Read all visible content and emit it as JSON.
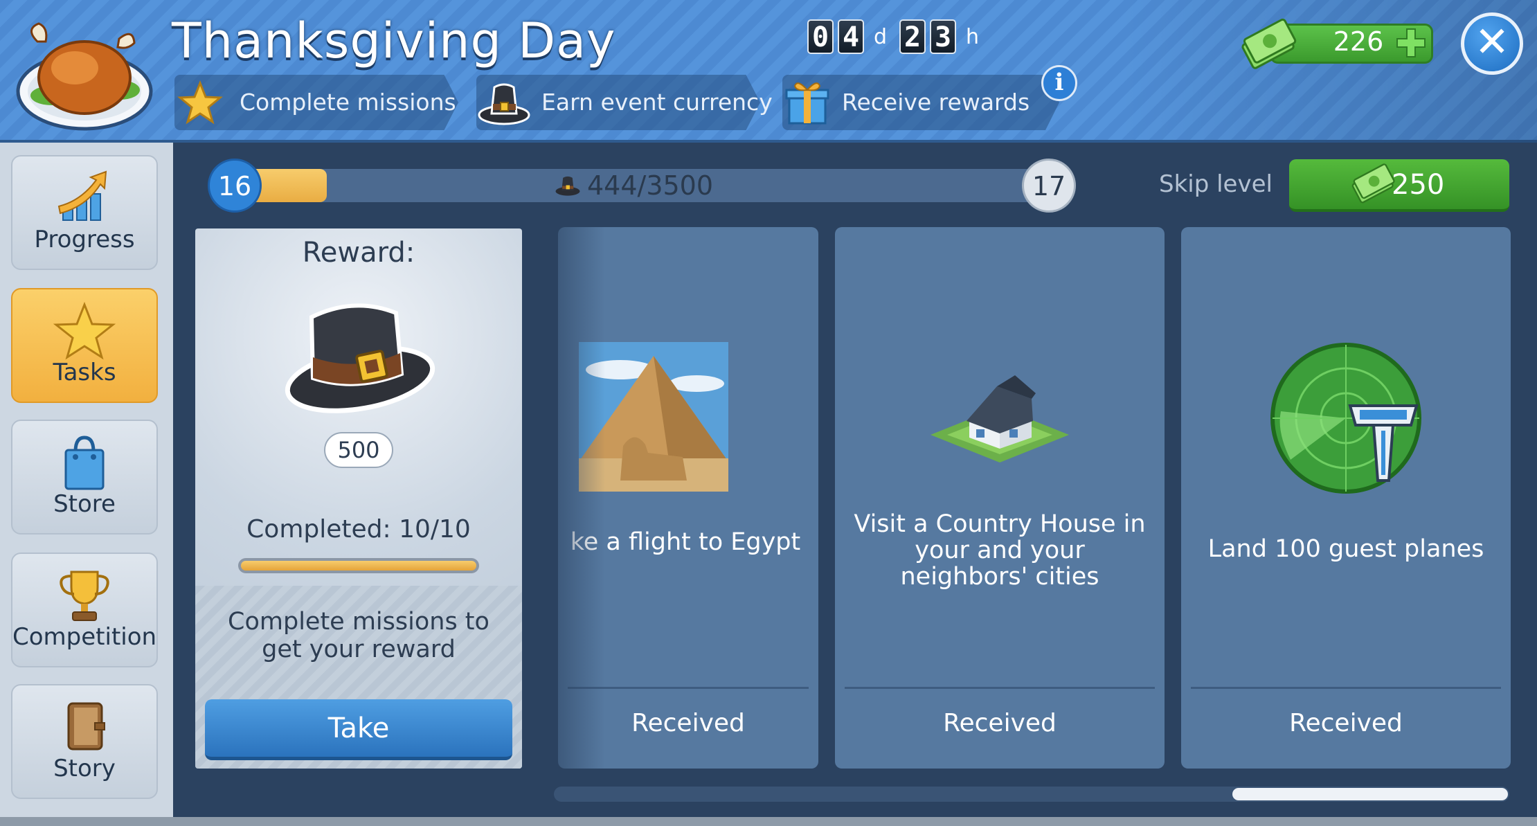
{
  "header": {
    "title": "Thanksgiving Day",
    "timer": {
      "days": [
        "0",
        "4"
      ],
      "days_unit": "d",
      "hours": [
        "2",
        "3"
      ],
      "hours_unit": "h"
    },
    "steps": [
      {
        "label": "Complete missions",
        "icon": "star-icon"
      },
      {
        "label": "Earn event currency",
        "icon": "pilgrim-hat-icon"
      },
      {
        "label": "Receive rewards",
        "icon": "gift-icon"
      }
    ],
    "info_label": "i",
    "cash": "226",
    "close_label": "✕"
  },
  "sidebar": {
    "items": [
      {
        "label": "Progress",
        "icon": "progress-chart-icon",
        "active": false
      },
      {
        "label": "Tasks",
        "icon": "star-icon",
        "active": true
      },
      {
        "label": "Store",
        "icon": "shopping-bag-icon",
        "active": false
      },
      {
        "label": "Competition",
        "icon": "trophy-icon",
        "active": false
      },
      {
        "label": "Story",
        "icon": "book-icon",
        "active": false
      }
    ]
  },
  "level": {
    "current": "16",
    "next": "17",
    "progress_text": "444/3500",
    "progress_fraction": 0.127,
    "skip_label": "Skip level",
    "skip_cost": "250"
  },
  "reward": {
    "title": "Reward:",
    "amount": "500",
    "completed_text": "Completed: 10/10",
    "completed_fraction": 1.0,
    "description": "Complete missions to get your reward",
    "take_label": "Take"
  },
  "tasks": [
    {
      "description": "ke a flight to Egypt",
      "status": "Received",
      "image": "pyramid-sphinx-image"
    },
    {
      "description": "Visit a Country House in your and your neighbors' cities",
      "status": "Received",
      "image": "country-house-image"
    },
    {
      "description": "Land 100 guest planes",
      "status": "Received",
      "image": "radar-tower-image"
    }
  ],
  "colors": {
    "header_blue": "#4d8ad2",
    "active_tab": "#f2b03f",
    "cash_green": "#3b9a2d",
    "card_blue": "#5679a0",
    "button_blue": "#2b73bd"
  }
}
